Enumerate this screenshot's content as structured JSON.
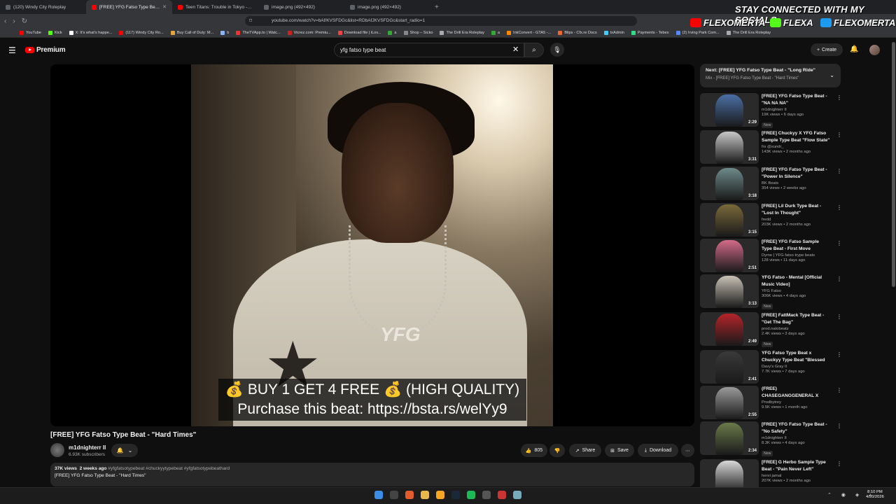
{
  "browser": {
    "tabs": [
      {
        "label": "(120) Windy City Roleplay",
        "active": false
      },
      {
        "label": "[FREE] YFG Fatso Type Beat -",
        "active": true
      },
      {
        "label": "Teen Titans: Trouble in Tokyo - Yo",
        "active": false
      },
      {
        "label": "image.png (492×492)",
        "active": false
      },
      {
        "label": "image.png (492×492)",
        "active": false
      }
    ],
    "new_tab": "+",
    "url": "youtube.com/watch?v=bAf/KVSFDGc&list=RDbAfJKVSFDGc&start_radio=1",
    "bookmarks": [
      "YouTube",
      "Kick",
      "X: It's what's happe...",
      "(117) Windy City Ro...",
      "Buy Call of Duty: M...",
      "b",
      "TheTVApp.to | Watc...",
      "Vicrez.com: Premiu...",
      "Download file | iLov...",
      "a",
      "Shop – Sicko",
      "The Drill Era Roleplay",
      "a",
      "InkConvert - GTA5 -...",
      "Blips - Cfx.re Docs",
      "txAdmin",
      "Payments - Tebex",
      "(2) Irving Park Com...",
      "The Drill Era Roleplay"
    ]
  },
  "overlay": {
    "title": "STAY CONNECTED WITH MY SOCIALS",
    "socials": [
      {
        "platform": "youtube-icon",
        "handle": "FLEXOMERTA",
        "color": "#ff0000"
      },
      {
        "platform": "kick-icon",
        "handle": "FLEXA",
        "color": "#53fc18"
      },
      {
        "platform": "x-icon",
        "handle": "FLEXOMERTA",
        "color": "#1d9bf0"
      }
    ]
  },
  "youtube": {
    "logo_text": "Premium",
    "search_value": "yfg fatso  type beat",
    "create_label": "Create"
  },
  "video": {
    "caption_line1": "💰 BUY 1 GET 4 FREE 💰 (HIGH QUALITY)",
    "caption_line2": "Purchase this beat: https://bsta.rs/welYy9",
    "pendant_text": "YFG",
    "title": "[FREE] YFG Fatso Type Beat - \"Hard Times\"",
    "channel": "m1dnighterr II",
    "subscribers": "6.93K subscribers",
    "likes": "805",
    "share_label": "Share",
    "save_label": "Save",
    "download_label": "Download",
    "views": "37K views",
    "age": "2 weeks ago",
    "tags": "#yfgfatsotypebeat #chuckyytypebeat #yfgfatsotypebeathard",
    "description": "[FREE] YFG Fatso Type Beat - \"Hard Times\""
  },
  "upnext": {
    "line1": "Next: [FREE] YFG Fatso Type Beat - \"Long Ride\"",
    "line2": "Mix - [FREE] YFG Fatso Type Beat - \"Hard Times\""
  },
  "sidebar": [
    {
      "title": "[FREE] YFG Fatso Type Beat - \"NA NA NA\"",
      "channel": "m1dnighterr II",
      "views": "19K views • 6 days ago",
      "badge": "New",
      "duration": "2:29",
      "color": "#4a6fa5"
    },
    {
      "title": "[FREE] Chuckyy X YFG Fatso Sample Type Beat \"Flow State\"",
      "channel": "frx @xundr_",
      "views": "143K views • 2 months ago",
      "badge": "",
      "duration": "3:31",
      "color": "#c8c8c8"
    },
    {
      "title": "[FREE] YFG Fatso Type Beat - \"Power In Silence\"",
      "channel": "BK Beats",
      "views": "354 views • 2 weeks ago",
      "badge": "",
      "duration": "3:18",
      "color": "#6e8a8a"
    },
    {
      "title": "[FREE] Lil Durk Type Beat - \"Lost In Thought\"",
      "channel": "fredd",
      "views": "203K views • 2 months ago",
      "badge": "",
      "duration": "3:15",
      "color": "#7a6a3a"
    },
    {
      "title": "[FREE] YFG Fatso Sample Type Beat - First Move",
      "channel": "Dyme | YFG fatso trype beats",
      "views": "128 views • 11 days ago",
      "badge": "",
      "duration": "2:51",
      "color": "#d46a8a"
    },
    {
      "title": "YFG Fatso - Mental [Official Music Video]",
      "channel": "YFG Fatso",
      "views": "306K views • 4 days ago",
      "badge": "New",
      "duration": "3:13",
      "color": "#c8c2b5"
    },
    {
      "title": "[FREE] FattMack Type Beat - \"Get The Bag\"",
      "channel": "prod.natobeatz",
      "views": "2.4K views • 3 days ago",
      "badge": "New",
      "duration": "2:49",
      "color": "#b3242a"
    },
    {
      "title": "YFG Fatso Type Beat x Chuckyy Type Beat \"Blessed Forever\" | ...",
      "channel": "Davy's Gray II",
      "views": "7.7K views • 7 days ago",
      "badge": "",
      "duration": "2:41",
      "color": "#3a3a3a"
    },
    {
      "title": "(FREE) CHASEGANGGENERAL X BABY WALK X GGJAYROD TY...",
      "channel": "Prodbytrey",
      "views": "9.5K views • 1 month ago",
      "badge": "",
      "duration": "2:55",
      "color": "#9a9a9a"
    },
    {
      "title": "[FREE] YFG Fatso Type Beat - \"No Safety\"",
      "channel": "m1dnighterr II",
      "views": "8.3K views • 4 days ago",
      "badge": "New",
      "duration": "2:34",
      "color": "#6a7a4a"
    },
    {
      "title": "[FREE] G Herbo Sample Type Beat - \"Pain Never Left\"",
      "channel": "henri jamal",
      "views": "207K views • 2 months ago",
      "badge": "",
      "duration": "",
      "color": "#d8d8d8"
    }
  ],
  "taskbar": {
    "time": "8:10 PM",
    "date": "4/20/2026"
  }
}
